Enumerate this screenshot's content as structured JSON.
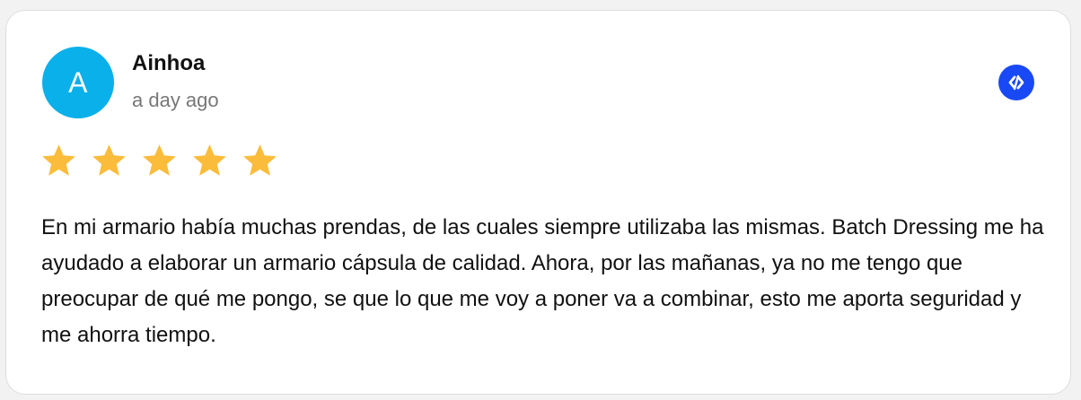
{
  "review": {
    "avatar_letter": "A",
    "reviewer_name": "Ainhoa",
    "date": "a day ago",
    "rating": 5,
    "rating_max": 5,
    "text": "En mi armario había muchas prendas, de las cuales siempre utilizaba las mismas. Batch Dressing me ha ayudado a elaborar un armario cápsula de calidad. Ahora, por las mañanas, ya no me tengo que preocupar de qué me pongo, se que lo que me voy a poner va a combinar, esto me aporta seguridad y me ahorra tiempo.",
    "source_icon": "source-logo-icon"
  },
  "colors": {
    "avatar_bg": "#0ab0ea",
    "star": "#fbbc3b",
    "badge_bg": "#1949f5",
    "card_bg": "#ffffff",
    "page_bg": "#f2f2f2"
  }
}
